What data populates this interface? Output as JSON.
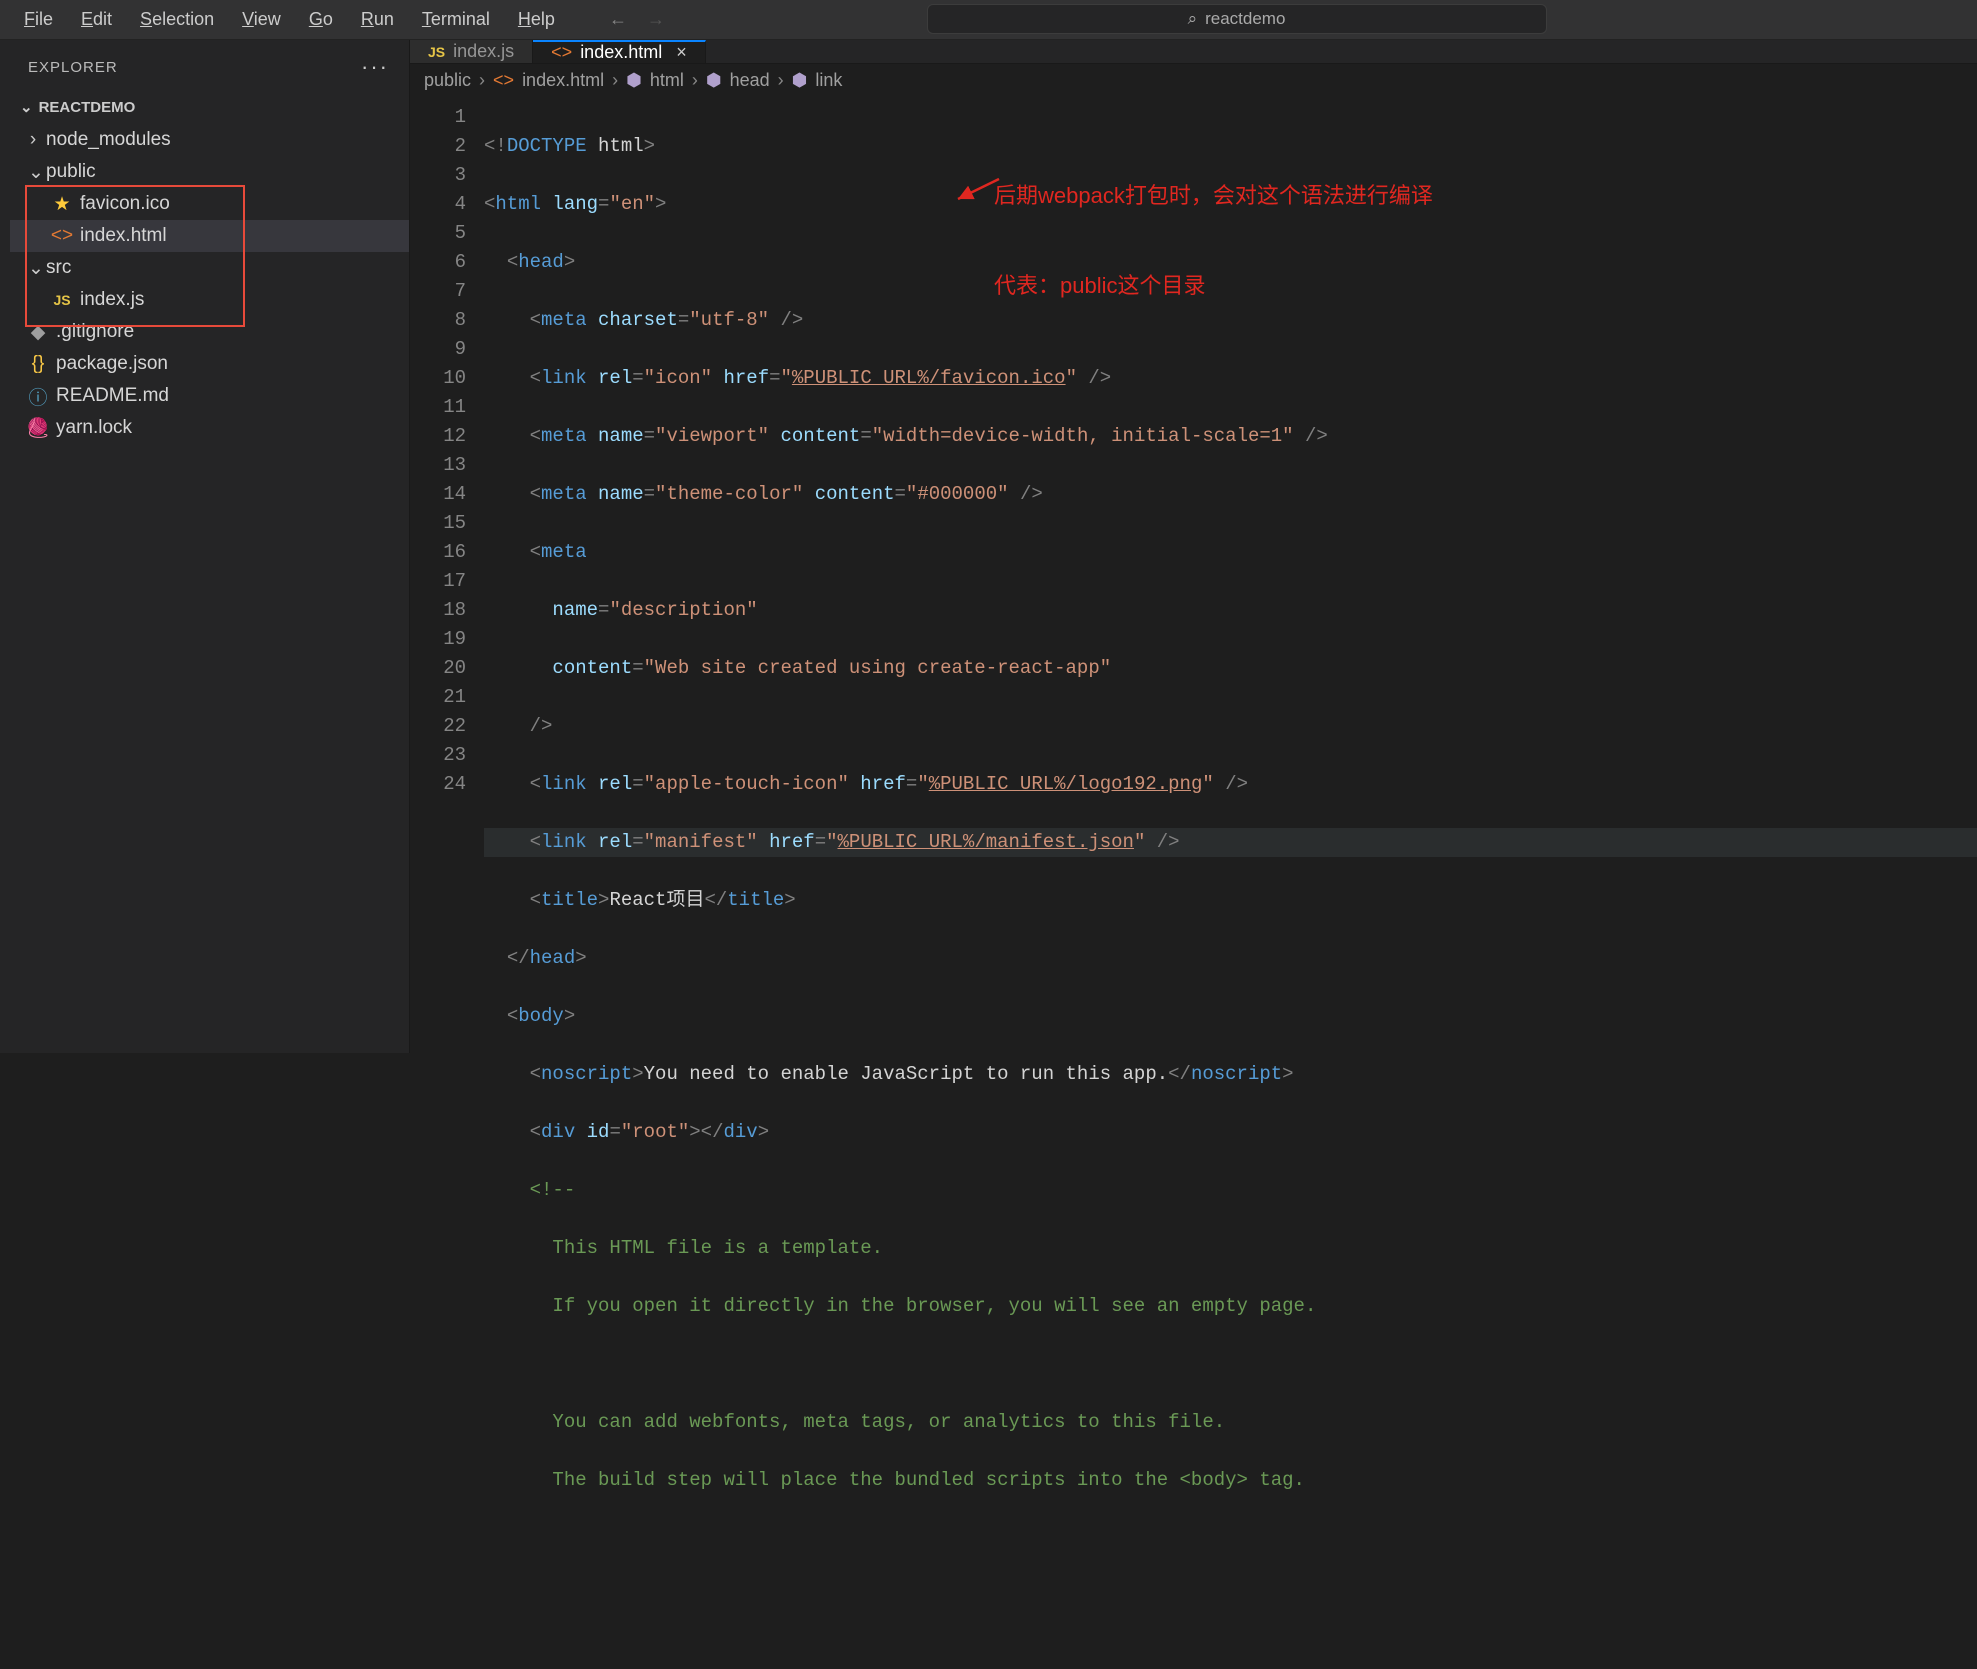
{
  "menubar": {
    "items": [
      "File",
      "Edit",
      "Selection",
      "View",
      "Go",
      "Run",
      "Terminal",
      "Help"
    ]
  },
  "search_top": {
    "text": "reactdemo"
  },
  "explorer": {
    "title": "EXPLORER",
    "project": "REACTDEMO",
    "tree": {
      "node_modules": "node_modules",
      "public": "public",
      "favicon": "favicon.ico",
      "indexhtml": "index.html",
      "src": "src",
      "indexjs": "index.js",
      "gitignore": ".gitignore",
      "packagejson": "package.json",
      "readme": "README.md",
      "yarnlock": "yarn.lock"
    }
  },
  "tabs": {
    "indexjs": "index.js",
    "indexhtml": "index.html"
  },
  "breadcrumbs": {
    "seg0": "public",
    "seg1": "index.html",
    "seg2": "html",
    "seg3": "head",
    "seg4": "link"
  },
  "annotation": {
    "line1": "后期webpack打包时，会对这个语法进行编译",
    "line2": "代表：public这个目录"
  },
  "code": {
    "lines": 24,
    "doctype": "DOCTYPE",
    "html_word": "html",
    "lang_attr": "lang",
    "lang_val": "\"en\"",
    "head": "head",
    "meta": "meta",
    "charset_attr": "charset",
    "charset_val": "\"utf-8\"",
    "link": "link",
    "rel_attr": "rel",
    "href_attr": "href",
    "icon_val": "\"icon\"",
    "favicon_href": "%PUBLIC_URL%/favicon.ico",
    "name_attr": "name",
    "content_attr": "content",
    "viewport_val": "\"viewport\"",
    "viewport_content": "\"width=device-width, initial-scale=1\"",
    "themecolor_val": "\"theme-color\"",
    "themecolor_content": "\"#000000\"",
    "description_val": "\"description\"",
    "description_content": "\"Web site created using create-react-app\"",
    "appletouch_val": "\"apple-touch-icon\"",
    "logo192_href": "%PUBLIC_URL%/logo192.png",
    "manifest_val": "\"manifest\"",
    "manifest_href": "%PUBLIC_URL%/manifest.json",
    "title": "title",
    "title_text": "React项目",
    "body": "body",
    "noscript": "noscript",
    "noscript_text": "You need to enable JavaScript to run this app.",
    "div": "div",
    "id_attr": "id",
    "root_val": "\"root\"",
    "comment_open": "<!--",
    "c1": "This HTML file is a template.",
    "c2": "If you open it directly in the browser, you will see an empty page.",
    "c3": "You can add webfonts, meta tags, or analytics to this file.",
    "c4": "The build step will place the bundled scripts into the <body> tag."
  }
}
